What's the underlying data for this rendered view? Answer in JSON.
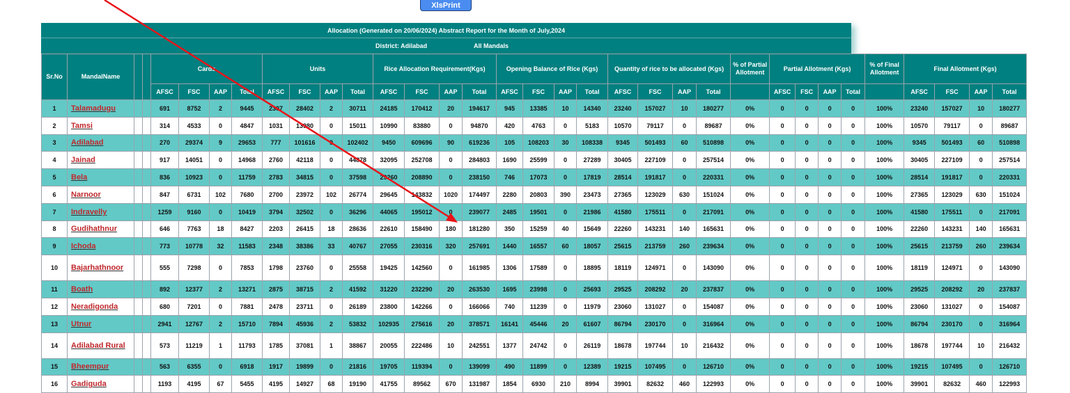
{
  "toolbar": {
    "xls_print_label": "XlsPrint"
  },
  "report": {
    "title": "Allocation (Generated on 20/06/2024) Abstract Report for the Month of July,2024",
    "district": "District: Adilabad",
    "mandals": "All Mandals"
  },
  "headers": {
    "sr_no": "Sr.No",
    "mandal_name": "MandalName",
    "cards": "Cards",
    "units": "Units",
    "rice_req": "Rice Allocation Requirement(Kgs)",
    "opening": "Opening Balance of Rice (Kgs)",
    "qty": "Quantity of rice to be allocated (Kgs)",
    "partial_pct": "% of Partial Allotment",
    "partial": "Partial Allotment (Kgs)",
    "final_pct": "% of Final Allotment",
    "final": "Final Allotment (Kgs)",
    "sub": [
      "AFSC",
      "FSC",
      "AAP",
      "Total"
    ]
  },
  "colors": {
    "header": "#008080",
    "odd_row": "#62c9c6",
    "link": "#c0282d",
    "button": "#4a8cf0"
  },
  "rows": [
    {
      "sr": "1",
      "name": "Talamadugu",
      "cards": [
        "691",
        "8752",
        "2",
        "9445"
      ],
      "units": [
        "2307",
        "28402",
        "2",
        "30711"
      ],
      "rice": [
        "24185",
        "170412",
        "20",
        "194617"
      ],
      "opening": [
        "945",
        "13385",
        "10",
        "14340"
      ],
      "qty": [
        "23240",
        "157027",
        "10",
        "180277"
      ],
      "partial_pct": "0%",
      "partial": [
        "0",
        "0",
        "0",
        "0"
      ],
      "final_pct": "100%",
      "final": [
        "23240",
        "157027",
        "10",
        "180277"
      ]
    },
    {
      "sr": "2",
      "name": "Tamsi",
      "cards": [
        "314",
        "4533",
        "0",
        "4847"
      ],
      "units": [
        "1031",
        "13980",
        "0",
        "15011"
      ],
      "rice": [
        "10990",
        "83880",
        "0",
        "94870"
      ],
      "opening": [
        "420",
        "4763",
        "0",
        "5183"
      ],
      "qty": [
        "10570",
        "79117",
        "0",
        "89687"
      ],
      "partial_pct": "0%",
      "partial": [
        "0",
        "0",
        "0",
        "0"
      ],
      "final_pct": "100%",
      "final": [
        "10570",
        "79117",
        "0",
        "89687"
      ]
    },
    {
      "sr": "3",
      "name": "Adilabad",
      "cards": [
        "270",
        "29374",
        "9",
        "29653"
      ],
      "units": [
        "777",
        "101616",
        "9",
        "102402"
      ],
      "rice": [
        "9450",
        "609696",
        "90",
        "619236"
      ],
      "opening": [
        "105",
        "108203",
        "30",
        "108338"
      ],
      "qty": [
        "9345",
        "501493",
        "60",
        "510898"
      ],
      "partial_pct": "0%",
      "partial": [
        "0",
        "0",
        "0",
        "0"
      ],
      "final_pct": "100%",
      "final": [
        "9345",
        "501493",
        "60",
        "510898"
      ]
    },
    {
      "sr": "4",
      "name": "Jainad",
      "cards": [
        "917",
        "14051",
        "0",
        "14968"
      ],
      "units": [
        "2760",
        "42118",
        "0",
        "44878"
      ],
      "rice": [
        "32095",
        "252708",
        "0",
        "284803"
      ],
      "opening": [
        "1690",
        "25599",
        "0",
        "27289"
      ],
      "qty": [
        "30405",
        "227109",
        "0",
        "257514"
      ],
      "partial_pct": "0%",
      "partial": [
        "0",
        "0",
        "0",
        "0"
      ],
      "final_pct": "100%",
      "final": [
        "30405",
        "227109",
        "0",
        "257514"
      ]
    },
    {
      "sr": "5",
      "name": "Bela",
      "cards": [
        "836",
        "10923",
        "0",
        "11759"
      ],
      "units": [
        "2783",
        "34815",
        "0",
        "37598"
      ],
      "rice": [
        "29260",
        "208890",
        "0",
        "238150"
      ],
      "opening": [
        "746",
        "17073",
        "0",
        "17819"
      ],
      "qty": [
        "28514",
        "191817",
        "0",
        "220331"
      ],
      "partial_pct": "0%",
      "partial": [
        "0",
        "0",
        "0",
        "0"
      ],
      "final_pct": "100%",
      "final": [
        "28514",
        "191817",
        "0",
        "220331"
      ]
    },
    {
      "sr": "6",
      "name": "Narnoor",
      "cards": [
        "847",
        "6731",
        "102",
        "7680"
      ],
      "units": [
        "2700",
        "23972",
        "102",
        "26774"
      ],
      "rice": [
        "29645",
        "143832",
        "1020",
        "174497"
      ],
      "opening": [
        "2280",
        "20803",
        "390",
        "23473"
      ],
      "qty": [
        "27365",
        "123029",
        "630",
        "151024"
      ],
      "partial_pct": "0%",
      "partial": [
        "0",
        "0",
        "0",
        "0"
      ],
      "final_pct": "100%",
      "final": [
        "27365",
        "123029",
        "630",
        "151024"
      ]
    },
    {
      "sr": "7",
      "name": "Indravelly",
      "cards": [
        "1259",
        "9160",
        "0",
        "10419"
      ],
      "units": [
        "3794",
        "32502",
        "0",
        "36296"
      ],
      "rice": [
        "44065",
        "195012",
        "0",
        "239077"
      ],
      "opening": [
        "2485",
        "19501",
        "0",
        "21986"
      ],
      "qty": [
        "41580",
        "175511",
        "0",
        "217091"
      ],
      "partial_pct": "0%",
      "partial": [
        "0",
        "0",
        "0",
        "0"
      ],
      "final_pct": "100%",
      "final": [
        "41580",
        "175511",
        "0",
        "217091"
      ]
    },
    {
      "sr": "8",
      "name": "Gudihathnur",
      "cards": [
        "646",
        "7763",
        "18",
        "8427"
      ],
      "units": [
        "2203",
        "26415",
        "18",
        "28636"
      ],
      "rice": [
        "22610",
        "158490",
        "180",
        "181280"
      ],
      "opening": [
        "350",
        "15259",
        "40",
        "15649"
      ],
      "qty": [
        "22260",
        "143231",
        "140",
        "165631"
      ],
      "partial_pct": "0%",
      "partial": [
        "0",
        "0",
        "0",
        "0"
      ],
      "final_pct": "100%",
      "final": [
        "22260",
        "143231",
        "140",
        "165631"
      ]
    },
    {
      "sr": "9",
      "name": "Ichoda",
      "cards": [
        "773",
        "10778",
        "32",
        "11583"
      ],
      "units": [
        "2348",
        "38386",
        "33",
        "40767"
      ],
      "rice": [
        "27055",
        "230316",
        "320",
        "257691"
      ],
      "opening": [
        "1440",
        "16557",
        "60",
        "18057"
      ],
      "qty": [
        "25615",
        "213759",
        "260",
        "239634"
      ],
      "partial_pct": "0%",
      "partial": [
        "0",
        "0",
        "0",
        "0"
      ],
      "final_pct": "100%",
      "final": [
        "25615",
        "213759",
        "260",
        "239634"
      ]
    },
    {
      "sr": "10",
      "name": "Bajarhathnoor",
      "cards": [
        "555",
        "7298",
        "0",
        "7853"
      ],
      "units": [
        "1798",
        "23760",
        "0",
        "25558"
      ],
      "rice": [
        "19425",
        "142560",
        "0",
        "161985"
      ],
      "opening": [
        "1306",
        "17589",
        "0",
        "18895"
      ],
      "qty": [
        "18119",
        "124971",
        "0",
        "143090"
      ],
      "partial_pct": "0%",
      "partial": [
        "0",
        "0",
        "0",
        "0"
      ],
      "final_pct": "100%",
      "final": [
        "18119",
        "124971",
        "0",
        "143090"
      ]
    },
    {
      "sr": "11",
      "name": "Boath",
      "cards": [
        "892",
        "12377",
        "2",
        "13271"
      ],
      "units": [
        "2875",
        "38715",
        "2",
        "41592"
      ],
      "rice": [
        "31220",
        "232290",
        "20",
        "263530"
      ],
      "opening": [
        "1695",
        "23998",
        "0",
        "25693"
      ],
      "qty": [
        "29525",
        "208292",
        "20",
        "237837"
      ],
      "partial_pct": "0%",
      "partial": [
        "0",
        "0",
        "0",
        "0"
      ],
      "final_pct": "100%",
      "final": [
        "29525",
        "208292",
        "20",
        "237837"
      ]
    },
    {
      "sr": "12",
      "name": "Neradigonda",
      "cards": [
        "680",
        "7201",
        "0",
        "7881"
      ],
      "units": [
        "2478",
        "23711",
        "0",
        "26189"
      ],
      "rice": [
        "23800",
        "142266",
        "0",
        "166066"
      ],
      "opening": [
        "740",
        "11239",
        "0",
        "11979"
      ],
      "qty": [
        "23060",
        "131027",
        "0",
        "154087"
      ],
      "partial_pct": "0%",
      "partial": [
        "0",
        "0",
        "0",
        "0"
      ],
      "final_pct": "100%",
      "final": [
        "23060",
        "131027",
        "0",
        "154087"
      ]
    },
    {
      "sr": "13",
      "name": "Utnur",
      "cards": [
        "2941",
        "12767",
        "2",
        "15710"
      ],
      "units": [
        "7894",
        "45936",
        "2",
        "53832"
      ],
      "rice": [
        "102935",
        "275616",
        "20",
        "378571"
      ],
      "opening": [
        "16141",
        "45446",
        "20",
        "61607"
      ],
      "qty": [
        "86794",
        "230170",
        "0",
        "316964"
      ],
      "partial_pct": "0%",
      "partial": [
        "0",
        "0",
        "0",
        "0"
      ],
      "final_pct": "100%",
      "final": [
        "86794",
        "230170",
        "0",
        "316964"
      ]
    },
    {
      "sr": "14",
      "name": "Adilabad Rural",
      "cards": [
        "573",
        "11219",
        "1",
        "11793"
      ],
      "units": [
        "1785",
        "37081",
        "1",
        "38867"
      ],
      "rice": [
        "20055",
        "222486",
        "10",
        "242551"
      ],
      "opening": [
        "1377",
        "24742",
        "0",
        "26119"
      ],
      "qty": [
        "18678",
        "197744",
        "10",
        "216432"
      ],
      "partial_pct": "0%",
      "partial": [
        "0",
        "0",
        "0",
        "0"
      ],
      "final_pct": "100%",
      "final": [
        "18678",
        "197744",
        "10",
        "216432"
      ]
    },
    {
      "sr": "15",
      "name": "Bheempur",
      "cards": [
        "563",
        "6355",
        "0",
        "6918"
      ],
      "units": [
        "1917",
        "19899",
        "0",
        "21816"
      ],
      "rice": [
        "19705",
        "119394",
        "0",
        "139099"
      ],
      "opening": [
        "490",
        "11899",
        "0",
        "12389"
      ],
      "qty": [
        "19215",
        "107495",
        "0",
        "126710"
      ],
      "partial_pct": "0%",
      "partial": [
        "0",
        "0",
        "0",
        "0"
      ],
      "final_pct": "100%",
      "final": [
        "19215",
        "107495",
        "0",
        "126710"
      ]
    },
    {
      "sr": "16",
      "name": "Gadiguda",
      "cards": [
        "1193",
        "4195",
        "67",
        "5455"
      ],
      "units": [
        "4195",
        "14927",
        "68",
        "19190"
      ],
      "rice": [
        "41755",
        "89562",
        "670",
        "131987"
      ],
      "opening": [
        "1854",
        "6930",
        "210",
        "8994"
      ],
      "qty": [
        "39901",
        "82632",
        "460",
        "122993"
      ],
      "partial_pct": "0%",
      "partial": [
        "0",
        "0",
        "0",
        "0"
      ],
      "final_pct": "100%",
      "final": [
        "39901",
        "82632",
        "460",
        "122993"
      ]
    }
  ]
}
